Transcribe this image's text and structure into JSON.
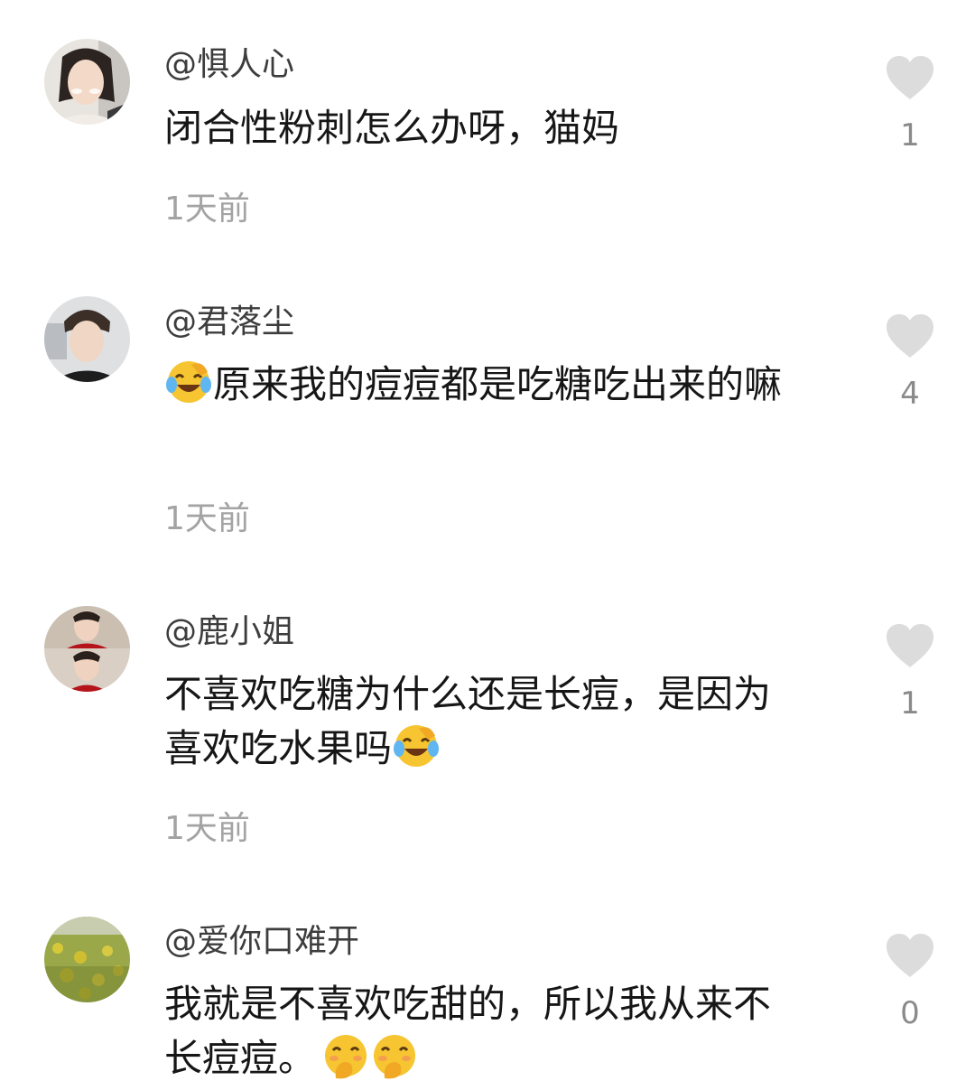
{
  "comments": [
    {
      "username": "@惧人心",
      "text": "闭合性粉刺怎么办呀，猫妈",
      "time": "1天前",
      "likes": "1",
      "avatar": "avatar-woman-photo"
    },
    {
      "username": "@君落尘",
      "text": "原来我的痘痘都是吃糖吃出来的嘛",
      "emoji_before": "laughing-crying-emoji",
      "time": "1天前",
      "likes": "4",
      "avatar": "avatar-man-photo"
    },
    {
      "username": "@鹿小姐",
      "text": "不喜欢吃糖为什么还是长痘，是因为喜欢吃水果吗",
      "emoji_after": "laughing-crying-emoji",
      "time": "1天前",
      "likes": "1",
      "avatar": "avatar-two-men-photo"
    },
    {
      "username": "@爱你口难开",
      "text": "我就是不喜欢吃甜的，所以我从来不长痘痘。",
      "emoji_after": "giggling-emoji",
      "time": "",
      "likes": "0",
      "avatar": "avatar-field-photo"
    }
  ],
  "colors": {
    "heart": "#dcdcdc",
    "time": "#a3a3a3",
    "username": "#3d3d3d",
    "text": "#161616"
  }
}
